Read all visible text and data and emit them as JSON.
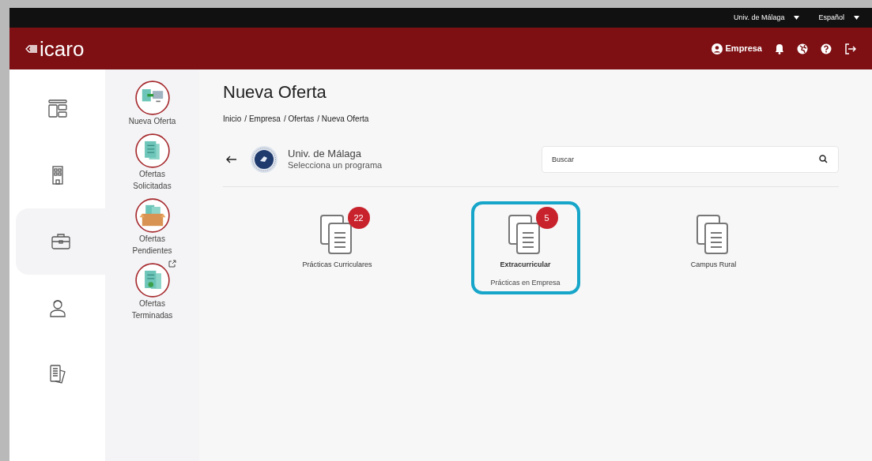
{
  "top_bar": {
    "institution": "Univ. de Málaga",
    "language": "Español"
  },
  "header": {
    "logo": "icaro",
    "user": "Empresa"
  },
  "rail": [
    {
      "kind": "dashboard",
      "selected": false
    },
    {
      "kind": "building",
      "selected": false
    },
    {
      "kind": "briefcase",
      "selected": true
    },
    {
      "kind": "person",
      "selected": false
    },
    {
      "kind": "documents",
      "selected": false
    }
  ],
  "submenu": [
    {
      "kind": "new",
      "label": "Nueva Oferta",
      "external": false
    },
    {
      "kind": "requested",
      "label": "Ofertas Solicitadas",
      "external": false
    },
    {
      "kind": "pending",
      "label": "Ofertas Pendientes",
      "external": false
    },
    {
      "kind": "finished",
      "label": "Ofertas Terminadas",
      "external": true
    }
  ],
  "page": {
    "title": "Nueva Oferta",
    "breadcrumb": [
      "Inicio",
      "/ Empresa",
      "/ Ofertas",
      "/ Nueva Oferta"
    ]
  },
  "institution": {
    "name": "Univ. de Málaga",
    "subtitle": "Selecciona un programa"
  },
  "search": {
    "placeholder": "Buscar"
  },
  "programs": [
    {
      "title": "Prácticas Curriculares",
      "badge": "22",
      "selected": false
    },
    {
      "title": "Extracurricular",
      "subtitle": "Prácticas en Empresa",
      "badge": "5",
      "selected": true
    },
    {
      "title": "Campus Rural",
      "selected": false
    }
  ]
}
